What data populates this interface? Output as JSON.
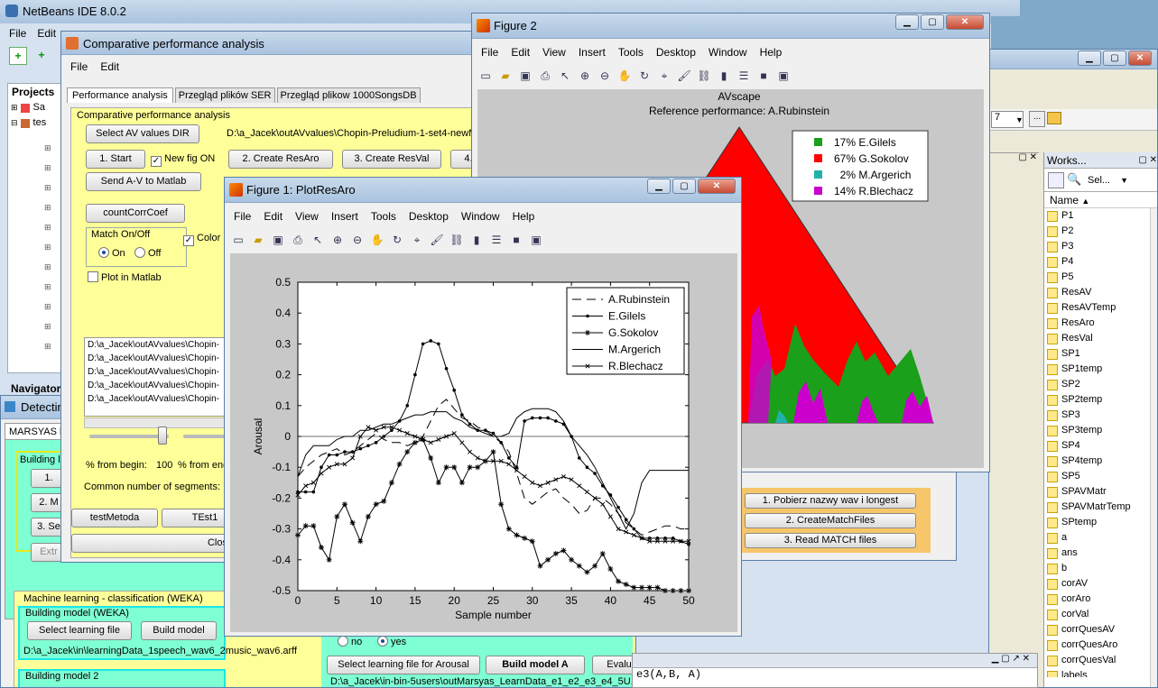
{
  "colors": {
    "desktop": "#7fa9c8",
    "yellow_panel": "#ffff99",
    "green_panel": "#7fffd4",
    "match_red": "#ff0000",
    "match_green": "#1aa01a",
    "match_cyan": "#20b2aa",
    "match_magenta": "#cc00cc"
  },
  "netbeans": {
    "title": "NetBeans IDE 8.0.2",
    "menu": [
      "File",
      "Edit"
    ],
    "projects_label": "Projects",
    "projects": [
      "Sa",
      "tes"
    ],
    "navigator_label": "Navigator"
  },
  "detecting": {
    "title": "Detectin",
    "tab": "MARSYAS b",
    "group1": "Building le",
    "buttons": [
      "1.",
      "2. M",
      "3. Se",
      "Extr"
    ],
    "ml_label": "Machine learning - classification (WEKA)",
    "bm_weka": "Building model (WEKA)",
    "select_learning": "Select learning file",
    "build_model": "Build model",
    "learning_path": "D:\\a_Jacek\\in\\learningData_1speech_wav6_2music_wav6.arff",
    "bm2": "Building model 2",
    "radio_no": "no",
    "radio_yes": "yes",
    "select_arousal": "Select learning file for Arousal",
    "build_model_a": "Build model A",
    "evaluate": "Evalu",
    "marsyas_path": "D:\\a_Jacek\\in-bin-5users\\outMarsyas_LearnData_e1_e2_e3_e4_5U..."
  },
  "cpa": {
    "title": "Comparative performance analysis",
    "menu": [
      "File",
      "Edit"
    ],
    "tabs": [
      "Performance analysis",
      "Przegląd plików SER",
      "Przegląd plikow 1000SongsDB"
    ],
    "panel_title": "Comparative performance analysis",
    "select_dir": "Select AV values DIR",
    "dir_path": "D:\\a_Jacek\\outAVvalues\\Chopin-Preludium-1-set4-newM",
    "start": "1. Start",
    "newfig": "New fig ON",
    "create_resaro": "2. Create ResAro",
    "create_resval": "3. Create ResVal",
    "btn4": "4.",
    "send_av": "Send A-V to Matlab",
    "countcorr": "countCorrCoef",
    "match_onoff": "Match On/Off",
    "on": "On",
    "off": "Off",
    "color": "Color",
    "plot_matlab": "Plot in Matlab",
    "files": [
      "D:\\a_Jacek\\outAVvalues\\Chopin-",
      "D:\\a_Jacek\\outAVvalues\\Chopin-",
      "D:\\a_Jacek\\outAVvalues\\Chopin-",
      "D:\\a_Jacek\\outAVvalues\\Chopin-",
      "D:\\a_Jacek\\outAVvalues\\Chopin-"
    ],
    "from_begin": "% from begin:",
    "from_begin_val": "100",
    "from_end": "% from end",
    "common_segments": "Common number of segments:",
    "testmetoda": "testMetoda",
    "test1": "TEst1",
    "close": "Clos"
  },
  "match": {
    "results": "sults",
    "btn1": "1. Pobierz nazwy wav i longest",
    "btn2": "2. CreateMatchFiles",
    "btn3": "3. Read MATCH files"
  },
  "workspace": {
    "title": "Works...",
    "select": "Sel...",
    "header": "Name",
    "combo": "7",
    "vars": [
      "P1",
      "P2",
      "P3",
      "P4",
      "P5",
      "ResAV",
      "ResAVTemp",
      "ResAro",
      "ResVal",
      "SP1",
      "SP1temp",
      "SP2",
      "SP2temp",
      "SP3",
      "SP3temp",
      "SP4",
      "SP4temp",
      "SP5",
      "SPAVMatr",
      "SPAVMatrTemp",
      "SPtemp",
      "a",
      "ans",
      "b",
      "corAV",
      "corAro",
      "corVal",
      "corrQuesAV",
      "corrQuesAro",
      "corrQuesVal",
      "labels"
    ]
  },
  "command": {
    "text": "e3(A,B, A)"
  },
  "fig2": {
    "title": "Figure 2",
    "menu": [
      "File",
      "Edit",
      "View",
      "Insert",
      "Tools",
      "Desktop",
      "Window",
      "Help"
    ],
    "plot_title": "AVscape",
    "plot_subtitle": "Reference performance: A.Rubinstein",
    "legend": [
      {
        "pct": "17%",
        "name": "E.Gilels",
        "color": "#1aa01a"
      },
      {
        "pct": "67%",
        "name": "G.Sokolov",
        "color": "#ff0000"
      },
      {
        "pct": "2%",
        "name": "M.Argerich",
        "color": "#20b2aa"
      },
      {
        "pct": "14%",
        "name": "R.Blechacz",
        "color": "#cc00cc"
      }
    ]
  },
  "fig1": {
    "title": "Figure 1: PlotResAro",
    "menu": [
      "File",
      "Edit",
      "View",
      "Insert",
      "Tools",
      "Desktop",
      "Window",
      "Help"
    ]
  },
  "chart_data": {
    "type": "line",
    "xlabel": "Sample number",
    "ylabel": "Arousal",
    "xlim": [
      0,
      50
    ],
    "ylim": [
      -0.5,
      0.5
    ],
    "xticks": [
      0,
      5,
      10,
      15,
      20,
      25,
      30,
      35,
      40,
      45,
      50
    ],
    "yticks": [
      0.5,
      0.4,
      0.3,
      0.2,
      0.1,
      0,
      -0.1,
      -0.2,
      -0.3,
      -0.4,
      -0.5
    ],
    "legend_position": "top-right",
    "series": [
      {
        "name": "A.Rubinstein",
        "style": "dash",
        "values": [
          -0.13,
          -0.1,
          -0.08,
          -0.06,
          -0.05,
          -0.04,
          -0.06,
          -0.05,
          -0.03,
          -0.01,
          0.01,
          -0.01,
          -0.02,
          -0.02,
          -0.03,
          -0.02,
          0,
          0.05,
          0.1,
          0.12,
          0.09,
          0.06,
          0.05,
          0.03,
          0.02,
          0,
          -0.02,
          -0.05,
          -0.12,
          -0.2,
          -0.22,
          -0.2,
          -0.18,
          -0.17,
          -0.2,
          -0.22,
          -0.25,
          -0.24,
          -0.2,
          -0.2,
          -0.22,
          -0.25,
          -0.28,
          -0.3,
          -0.32,
          -0.31,
          -0.3,
          -0.29,
          -0.29,
          -0.3,
          -0.3
        ]
      },
      {
        "name": "E.Gilels",
        "style": "dot",
        "values": [
          -0.18,
          -0.18,
          -0.18,
          -0.1,
          -0.06,
          -0.06,
          -0.05,
          -0.05,
          -0.04,
          -0.03,
          -0.02,
          0,
          0.02,
          0.05,
          0.1,
          0.2,
          0.3,
          0.31,
          0.3,
          0.22,
          0.15,
          0.07,
          0.04,
          0.02,
          0.02,
          0.01,
          -0.02,
          -0.07,
          -0.1,
          0.05,
          0.06,
          0.06,
          0.06,
          0.05,
          0.04,
          0,
          -0.07,
          -0.1,
          -0.12,
          -0.16,
          -0.19,
          -0.23,
          -0.27,
          -0.3,
          -0.33,
          -0.33,
          -0.33,
          -0.33,
          -0.33,
          -0.34,
          -0.35
        ]
      },
      {
        "name": "G.Sokolov",
        "style": "star",
        "values": [
          -0.32,
          -0.29,
          -0.29,
          -0.36,
          -0.4,
          -0.26,
          -0.22,
          -0.28,
          -0.34,
          -0.26,
          -0.22,
          -0.21,
          -0.15,
          -0.09,
          -0.05,
          -0.02,
          -0.01,
          -0.07,
          -0.15,
          -0.1,
          -0.1,
          -0.15,
          -0.1,
          -0.1,
          -0.08,
          -0.05,
          -0.22,
          -0.3,
          -0.32,
          -0.33,
          -0.34,
          -0.42,
          -0.4,
          -0.38,
          -0.37,
          -0.4,
          -0.42,
          -0.44,
          -0.42,
          -0.38,
          -0.43,
          -0.47,
          -0.48,
          -0.49,
          -0.49,
          -0.49,
          -0.49,
          -0.5,
          -0.5,
          -0.5,
          -0.5
        ]
      },
      {
        "name": "M.Argerich",
        "style": "solid",
        "values": [
          -0.13,
          -0.06,
          -0.03,
          -0.03,
          -0.03,
          -0.01,
          0,
          0,
          0.02,
          0.02,
          0.03,
          0.04,
          0.04,
          0.05,
          0.06,
          0.07,
          0.07,
          0.08,
          0.08,
          0.08,
          0.06,
          0.05,
          0.03,
          0.02,
          0.01,
          0,
          0,
          0.01,
          0.06,
          0.08,
          0.09,
          0.09,
          0.09,
          0.08,
          0.05,
          0,
          -0.03,
          -0.06,
          -0.1,
          -0.15,
          -0.2,
          -0.25,
          -0.3,
          -0.25,
          -0.15,
          -0.11,
          -0.11,
          -0.11,
          -0.11,
          -0.11,
          -0.11
        ]
      },
      {
        "name": "R.Blechacz",
        "style": "x",
        "values": [
          -0.19,
          -0.16,
          -0.15,
          -0.12,
          -0.1,
          -0.09,
          -0.09,
          -0.07,
          0,
          0.03,
          0.02,
          0.03,
          0.03,
          0.02,
          0.01,
          0,
          -0.01,
          -0.02,
          -0.01,
          0,
          0.01,
          -0.02,
          -0.05,
          -0.07,
          -0.08,
          -0.08,
          -0.08,
          -0.09,
          -0.11,
          -0.13,
          -0.15,
          -0.16,
          -0.15,
          -0.14,
          -0.13,
          -0.14,
          -0.16,
          -0.18,
          -0.2,
          -0.22,
          -0.26,
          -0.3,
          -0.31,
          -0.32,
          -0.33,
          -0.34,
          -0.34,
          -0.34,
          -0.34,
          -0.34,
          -0.34
        ]
      }
    ]
  }
}
